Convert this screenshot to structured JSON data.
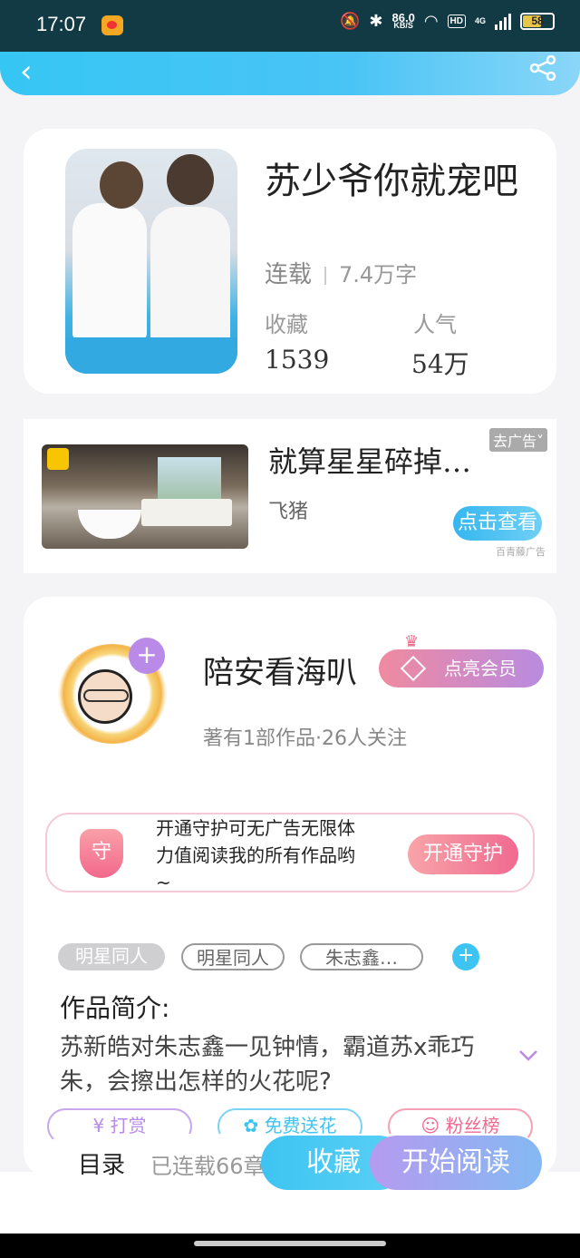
{
  "status_bar": {
    "time": "17:07",
    "net_speed": "86.0",
    "net_unit": "KB/S",
    "hd": "HD",
    "signal": "4G",
    "battery": "58"
  },
  "book": {
    "title": "苏少爷你就宠吧",
    "status": "连载",
    "word_count": "7.4万字",
    "fav_label": "收藏",
    "fav_value": "1539",
    "pop_label": "人气",
    "pop_value": "54万"
  },
  "ad": {
    "title": "就算星星碎掉…",
    "close": "去广告",
    "brand": "飞猪",
    "button": "点击查看",
    "source": "百青藤广告"
  },
  "author": {
    "name": "陪安看海叭",
    "vip_label": "点亮会员",
    "meta": "著有1部作品·26人关注"
  },
  "guard": {
    "icon_char": "守",
    "text": "开通守护可无广告无限体力值阅读我的所有作品哟~",
    "button": "开通守护"
  },
  "tags": [
    "明星同人",
    "明星同人",
    "朱志鑫…"
  ],
  "intro": {
    "heading": "作品简介:",
    "text": "苏新皓对朱志鑫一见钟情，霸道苏x乖巧朱，会擦出怎样的火花呢?"
  },
  "actions": [
    "打赏",
    "免费送花",
    "粉丝榜"
  ],
  "bottom_nav": {
    "toc": "目录",
    "serial": "已连载66章",
    "favorite": "收藏",
    "start_reading": "开始阅读"
  },
  "colors": {
    "accent": "#3ec4f2",
    "vip_start": "#f08aa0",
    "vip_end": "#b88be0",
    "status_bar": "#123a44"
  }
}
